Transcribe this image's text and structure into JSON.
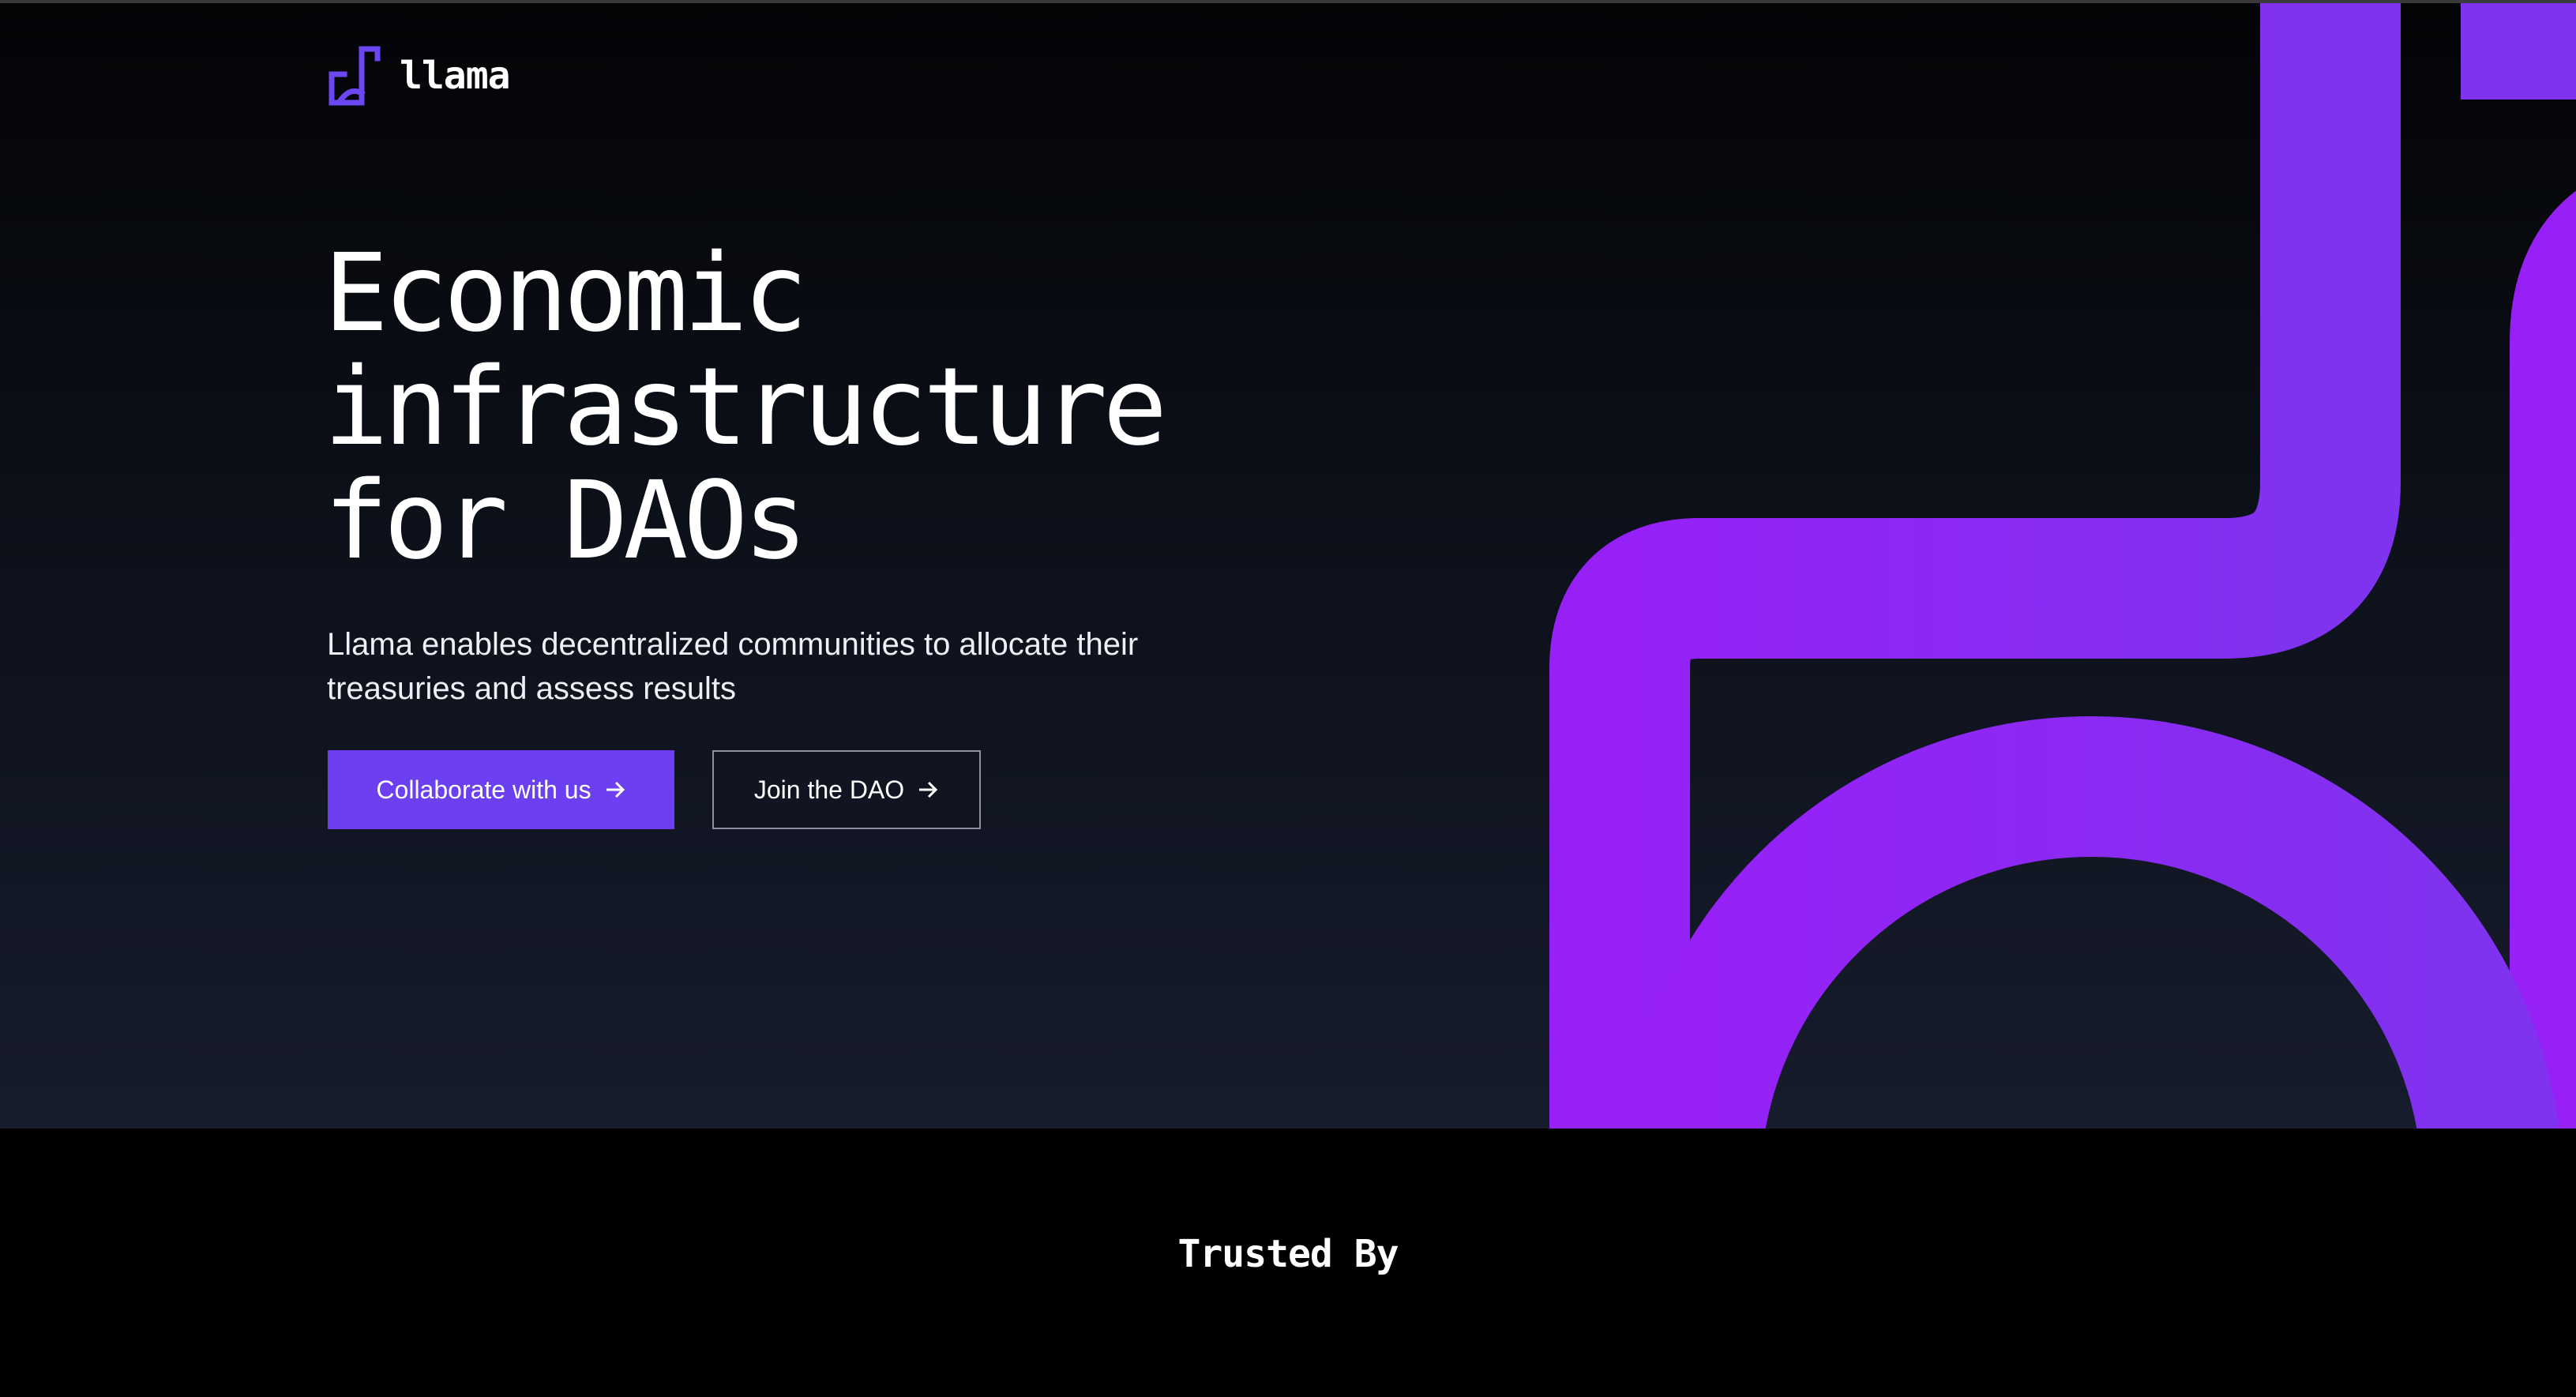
{
  "brand": {
    "name": "llama",
    "logo_icon": "llama-logo-icon"
  },
  "hero": {
    "headline_lines": [
      "Economic",
      "infrastructure",
      "for DAOs"
    ],
    "subtitle": "Llama enables decentralized communities to allocate their treasuries and assess results",
    "primary_button": {
      "label": "Collaborate with us",
      "icon": "arrow-right-icon"
    },
    "secondary_button": {
      "label": "Join the DAO",
      "icon": "arrow-right-icon"
    }
  },
  "trusted_by": {
    "heading": "Trusted By"
  },
  "colors": {
    "accent": "#6c40f0",
    "decor_purple": "#8b2cf5",
    "hero_top": "#030406",
    "hero_bottom": "#171c2d",
    "footer_bg": "#000000"
  }
}
